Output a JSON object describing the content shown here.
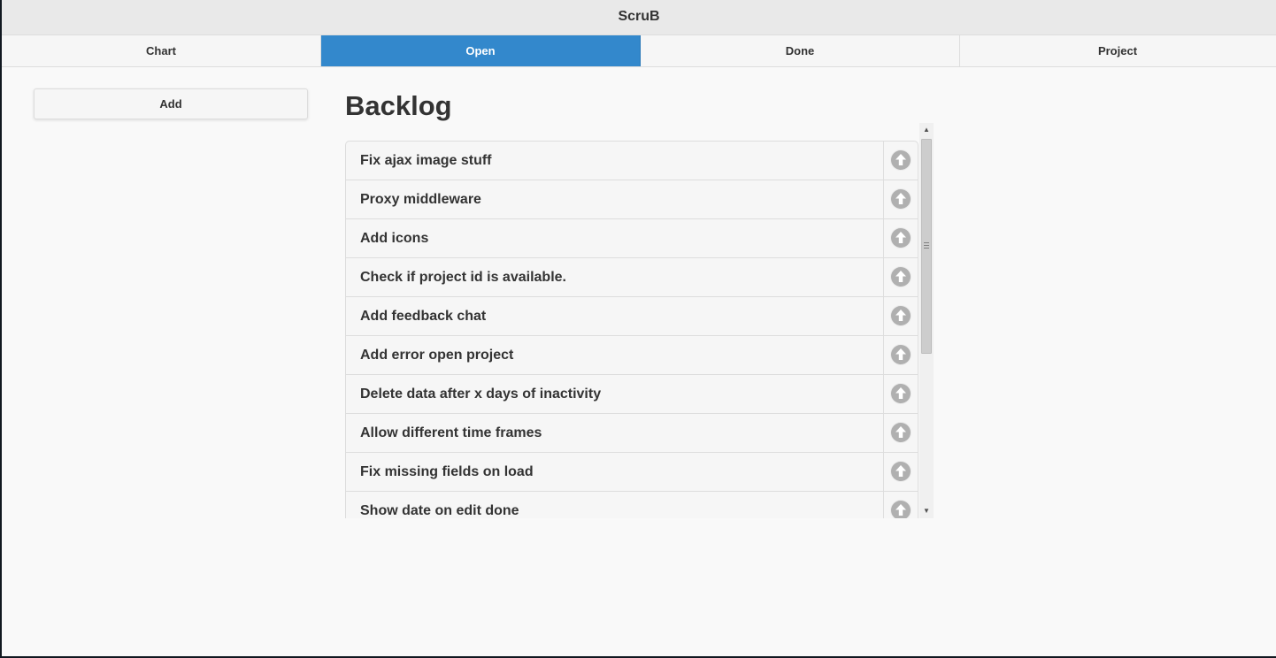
{
  "app": {
    "title": "ScruB"
  },
  "nav": {
    "tabs": [
      {
        "label": "Chart",
        "active": false
      },
      {
        "label": "Open",
        "active": true
      },
      {
        "label": "Done",
        "active": false
      },
      {
        "label": "Project",
        "active": false
      }
    ]
  },
  "sidebar": {
    "add_label": "Add"
  },
  "main": {
    "title": "Backlog",
    "items": [
      {
        "label": "Fix ajax image stuff",
        "action_icon": "arrow-up-circle-icon"
      },
      {
        "label": "Proxy middleware",
        "action_icon": "arrow-up-circle-icon"
      },
      {
        "label": "Add icons",
        "action_icon": "arrow-up-circle-icon"
      },
      {
        "label": "Check if project id is available.",
        "action_icon": "arrow-up-circle-icon"
      },
      {
        "label": "Add feedback chat",
        "action_icon": "arrow-up-circle-icon"
      },
      {
        "label": "Add error open project",
        "action_icon": "arrow-up-circle-icon"
      },
      {
        "label": "Delete data after x days of inactivity",
        "action_icon": "arrow-up-circle-icon"
      },
      {
        "label": "Allow different time frames",
        "action_icon": "arrow-up-circle-icon"
      },
      {
        "label": "Fix missing fields on load",
        "action_icon": "arrow-up-circle-icon"
      },
      {
        "label": "Show date on edit done",
        "action_icon": "arrow-up-circle-icon"
      }
    ]
  },
  "colors": {
    "accent": "#3388cc",
    "page_background": "#f9f9f9",
    "header_background": "#e9e9e9",
    "text": "#333333",
    "icon": "#b0b0b0"
  }
}
